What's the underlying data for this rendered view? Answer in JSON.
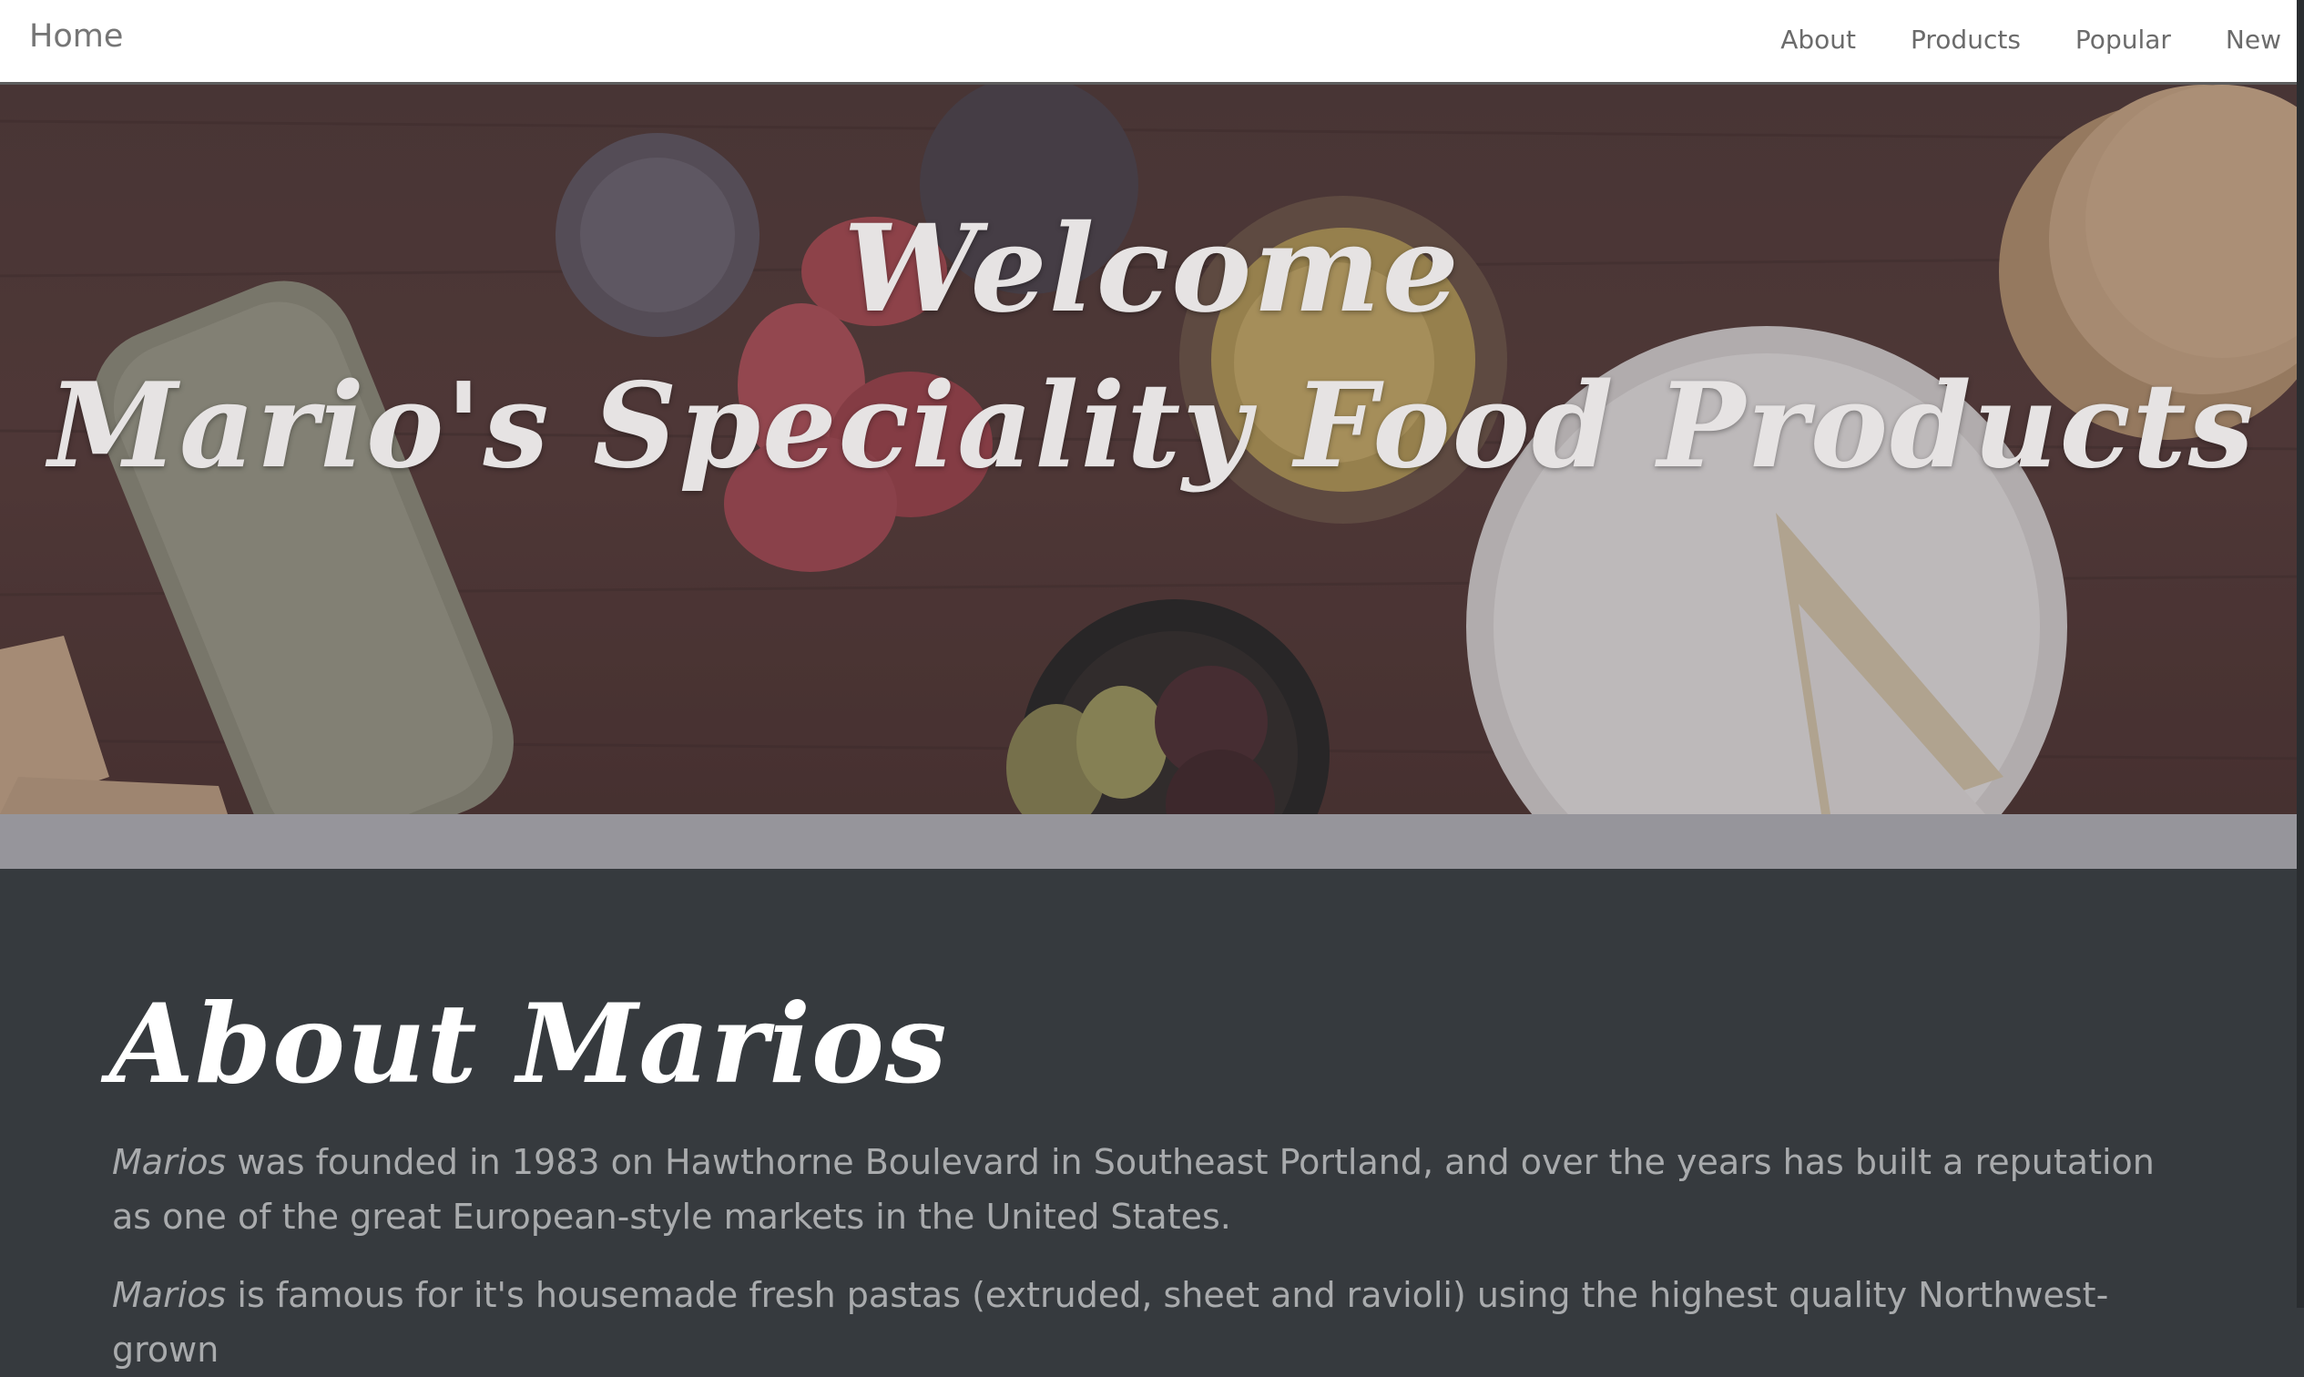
{
  "nav": {
    "brand": "Home",
    "links": [
      "About",
      "Products",
      "Popular",
      "New"
    ]
  },
  "hero": {
    "line1": "Welcome",
    "line2": "Mario's Speciality Food Products"
  },
  "about": {
    "heading": "About Marios",
    "p1_name": "Marios",
    "p1_text": " was founded in 1983 on Hawthorne Boulevard in Southeast Portland, and over the years has built a reputation as one of the great European-style markets in the United States.",
    "p2_name": "Marios",
    "p2_text": " is famous for it's housemade fresh pastas (extruded, sheet and ravioli) using the highest quality Northwest-grown"
  },
  "colors": {
    "nav_bg": "#ffffff",
    "page_bg": "#363a3e",
    "strip": "#96959b",
    "hero_text": "#e6e3e3"
  }
}
